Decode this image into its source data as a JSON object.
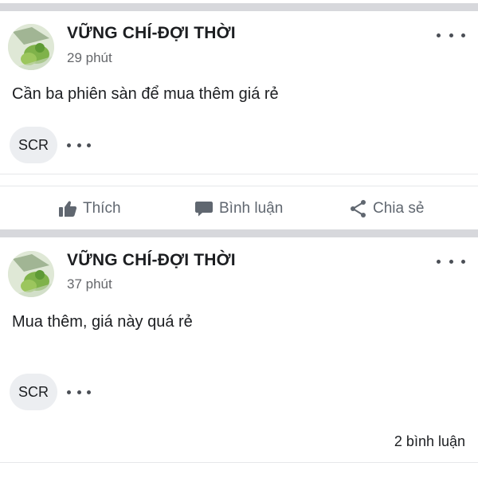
{
  "posts": [
    {
      "author": "VỮNG CHÍ-ĐỢI THỜI",
      "time": "29 phút",
      "text": "Cần ba phiên sàn để mua thêm giá rẻ",
      "tag": "SCR"
    },
    {
      "author": "VỮNG CHÍ-ĐỢI THỜI",
      "time": "37 phút",
      "text": "Mua thêm, giá này quá rẻ",
      "tag": "SCR",
      "comments_count": "2 bình luận"
    }
  ],
  "actions": {
    "like": "Thích",
    "comment": "Bình luận",
    "share": "Chia sẻ"
  },
  "colors": {
    "separator": "#d7d8dc",
    "muted_text": "#65676b",
    "action_text": "#606770",
    "tag_bg": "#eceef1"
  },
  "icons": [
    "thumbs-up-icon",
    "comment-bubble-icon",
    "share-icon",
    "more-options-icon"
  ]
}
